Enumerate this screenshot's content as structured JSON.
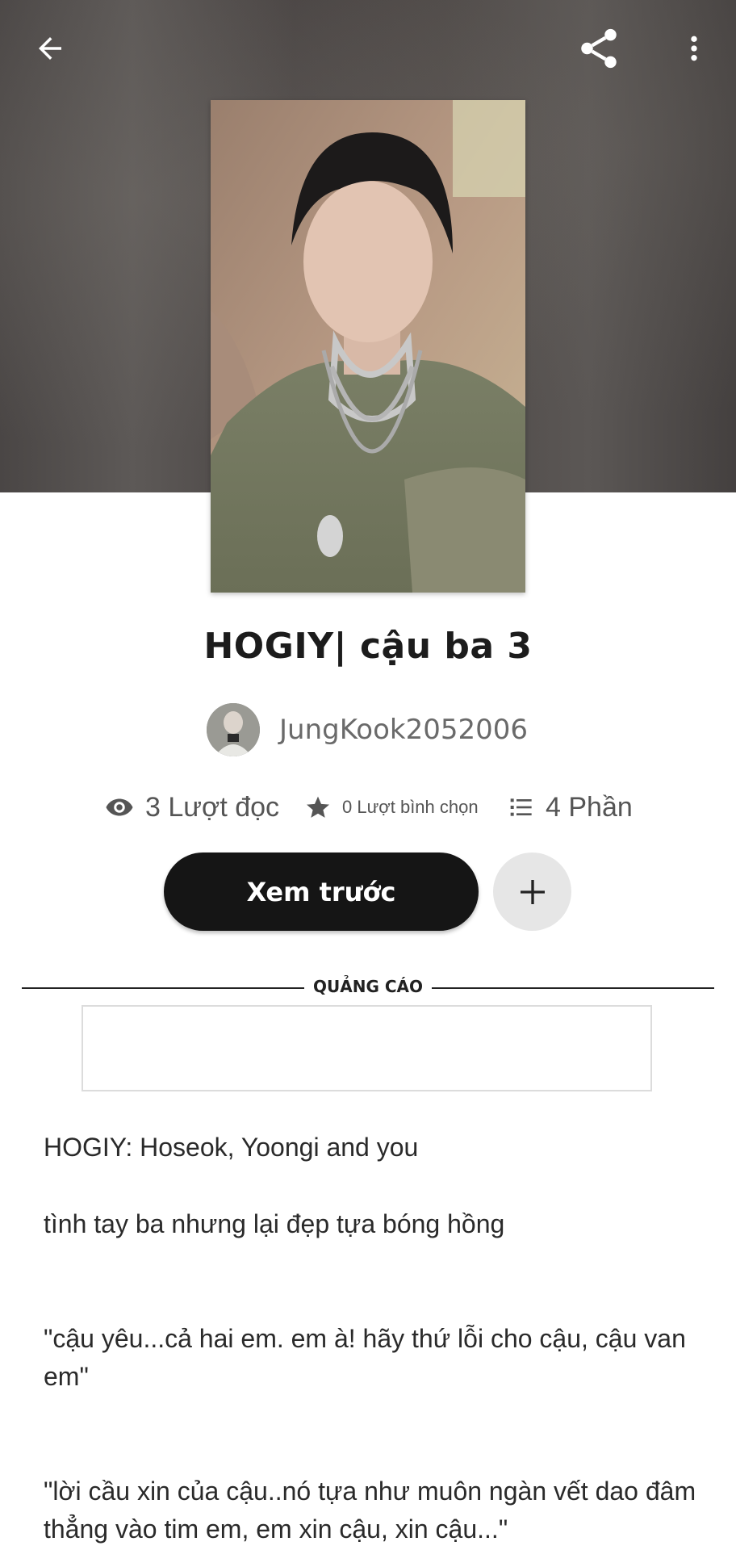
{
  "story": {
    "title": "HOGIY| cậu ba 3",
    "author": "JungKook2052006"
  },
  "stats": {
    "reads": "3 Lượt đọc",
    "votes": "0 Lượt bình chọn",
    "parts": "4 Phần"
  },
  "actions": {
    "preview_label": "Xem trước"
  },
  "ad": {
    "label": "QUẢNG CÁO"
  },
  "description": {
    "paragraphs": [
      "HOGIY: Hoseok, Yoongi and you",
      "tình tay ba nhưng lại đẹp tựa bóng hồng",
      "\"cậu yêu...cả hai em. em à! hãy thứ lỗi cho cậu, cậu van em\"",
      "\"lời cầu xin của cậu..nó tựa như muôn ngàn vết dao đâm thẳng vào tim em, em xin cậu, xin cậu...\""
    ]
  },
  "icons": {
    "back": "arrow-left",
    "share": "share-nodes",
    "more": "vertical-ellipsis",
    "reads": "eye",
    "votes": "star",
    "parts": "list",
    "add": "plus"
  },
  "colors": {
    "primary_button": "#151515",
    "secondary_button": "#e6e6e6",
    "hero_background": "#4d4948"
  }
}
